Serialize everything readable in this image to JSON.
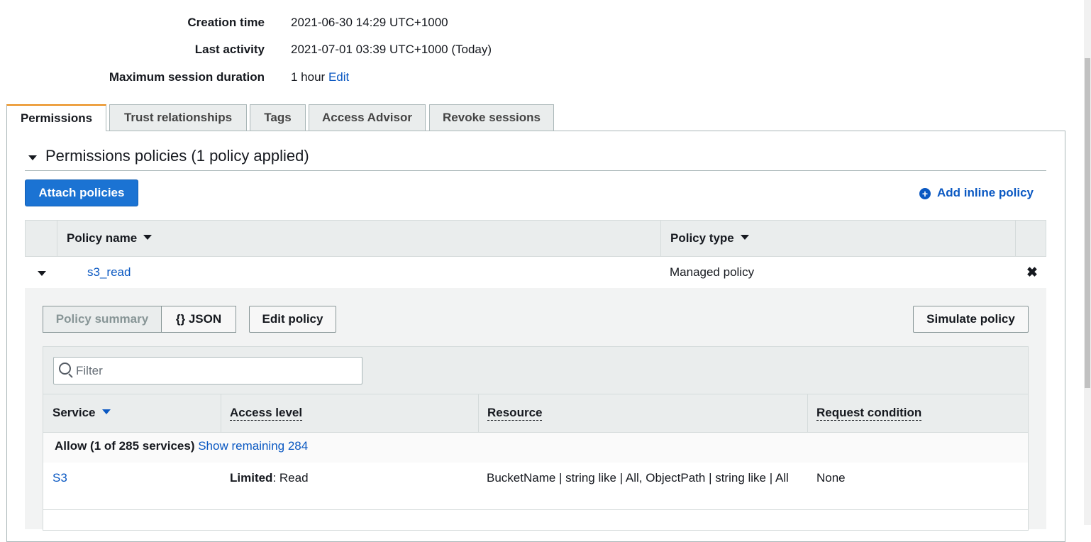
{
  "summary": {
    "creation_time_label": "Creation time",
    "creation_time_value": "2021-06-30 14:29 UTC+1000",
    "last_activity_label": "Last activity",
    "last_activity_value": "2021-07-01 03:39 UTC+1000 (Today)",
    "max_session_label": "Maximum session duration",
    "max_session_value": "1 hour",
    "max_session_edit": "Edit"
  },
  "tabs": [
    {
      "label": "Permissions",
      "active": true
    },
    {
      "label": "Trust relationships",
      "active": false
    },
    {
      "label": "Tags",
      "active": false
    },
    {
      "label": "Access Advisor",
      "active": false
    },
    {
      "label": "Revoke sessions",
      "active": false
    }
  ],
  "permissions": {
    "section_title": "Permissions policies (1 policy applied)",
    "attach_button": "Attach policies",
    "add_inline": "Add inline policy",
    "table": {
      "col_policy_name": "Policy name",
      "col_policy_type": "Policy type",
      "rows": [
        {
          "name": "s3_read",
          "type": "Managed policy"
        }
      ]
    },
    "expanded": {
      "seg_summary": "Policy summary",
      "seg_json": "{} JSON",
      "edit_policy": "Edit policy",
      "simulate_policy": "Simulate policy",
      "filter_placeholder": "Filter",
      "columns": {
        "service": "Service",
        "access_level": "Access level",
        "resource": "Resource",
        "request_condition": "Request condition"
      },
      "allow_text": "Allow (1 of 285 services)",
      "show_remaining": "Show remaining 284",
      "services": [
        {
          "service": "S3",
          "access_level_bold": "Limited",
          "access_level_rest": ": Read",
          "resource": "BucketName | string like | All, ObjectPath | string like | All",
          "request_condition": "None"
        }
      ]
    }
  },
  "colors": {
    "link": "#0a58c2",
    "primary_button": "#1b73d3",
    "active_tab_accent": "#e98a14"
  }
}
